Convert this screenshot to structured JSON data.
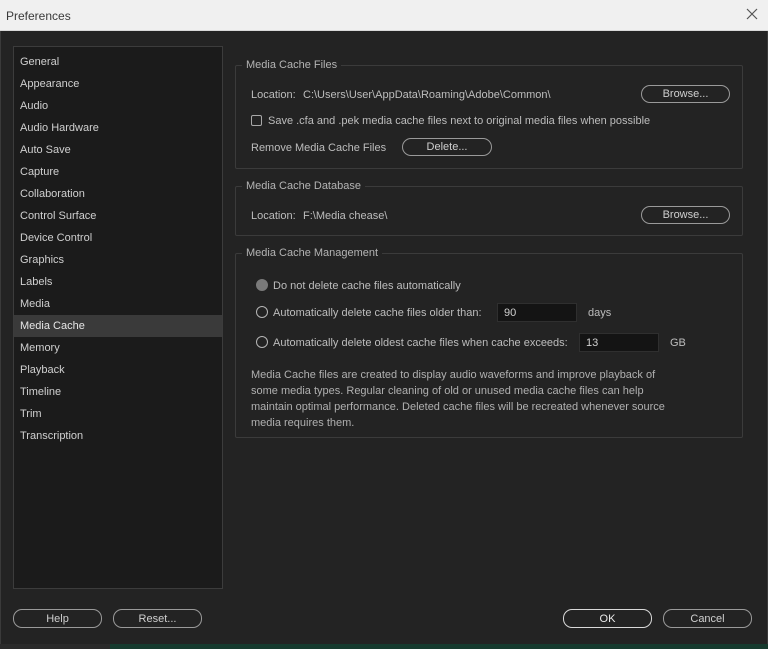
{
  "window": {
    "title": "Preferences"
  },
  "sidebar": {
    "items": [
      {
        "label": "General"
      },
      {
        "label": "Appearance"
      },
      {
        "label": "Audio"
      },
      {
        "label": "Audio Hardware"
      },
      {
        "label": "Auto Save"
      },
      {
        "label": "Capture"
      },
      {
        "label": "Collaboration"
      },
      {
        "label": "Control Surface"
      },
      {
        "label": "Device Control"
      },
      {
        "label": "Graphics"
      },
      {
        "label": "Labels"
      },
      {
        "label": "Media"
      },
      {
        "label": "Media Cache",
        "selected": true
      },
      {
        "label": "Memory"
      },
      {
        "label": "Playback"
      },
      {
        "label": "Timeline"
      },
      {
        "label": "Trim"
      },
      {
        "label": "Transcription"
      }
    ]
  },
  "cache_files": {
    "legend": "Media Cache Files",
    "location_label": "Location:",
    "location_value": "C:\\Users\\User\\AppData\\Roaming\\Adobe\\Common\\",
    "browse_label": "Browse...",
    "save_next_label": "Save .cfa and .pek media cache files next to original media files when possible",
    "save_next_checked": false,
    "remove_label": "Remove Media Cache Files",
    "delete_label": "Delete..."
  },
  "cache_db": {
    "legend": "Media Cache Database",
    "location_label": "Location:",
    "location_value": "F:\\Media chease\\",
    "browse_label": "Browse..."
  },
  "cache_mgmt": {
    "legend": "Media Cache Management",
    "opt_none_label": "Do not delete cache files automatically",
    "opt_age_label": "Automatically delete cache files older than:",
    "age_value": "90",
    "age_unit": "days",
    "opt_size_label": "Automatically delete oldest cache files when cache exceeds:",
    "size_value": "13",
    "size_unit": "GB",
    "selected_option": "none",
    "description": "Media Cache files are created to display audio waveforms and improve playback of some media types.  Regular cleaning of old or unused media cache files can help maintain optimal performance. Deleted cache files will be recreated whenever source media requires them."
  },
  "footer": {
    "help_label": "Help",
    "reset_label": "Reset...",
    "ok_label": "OK",
    "cancel_label": "Cancel"
  },
  "colors": {
    "dialog_bg": "#232323",
    "sidebar_bg": "#1b1b1b",
    "selected_bg": "#3a3a3a",
    "titlebar_bg": "#f0f0f0"
  }
}
